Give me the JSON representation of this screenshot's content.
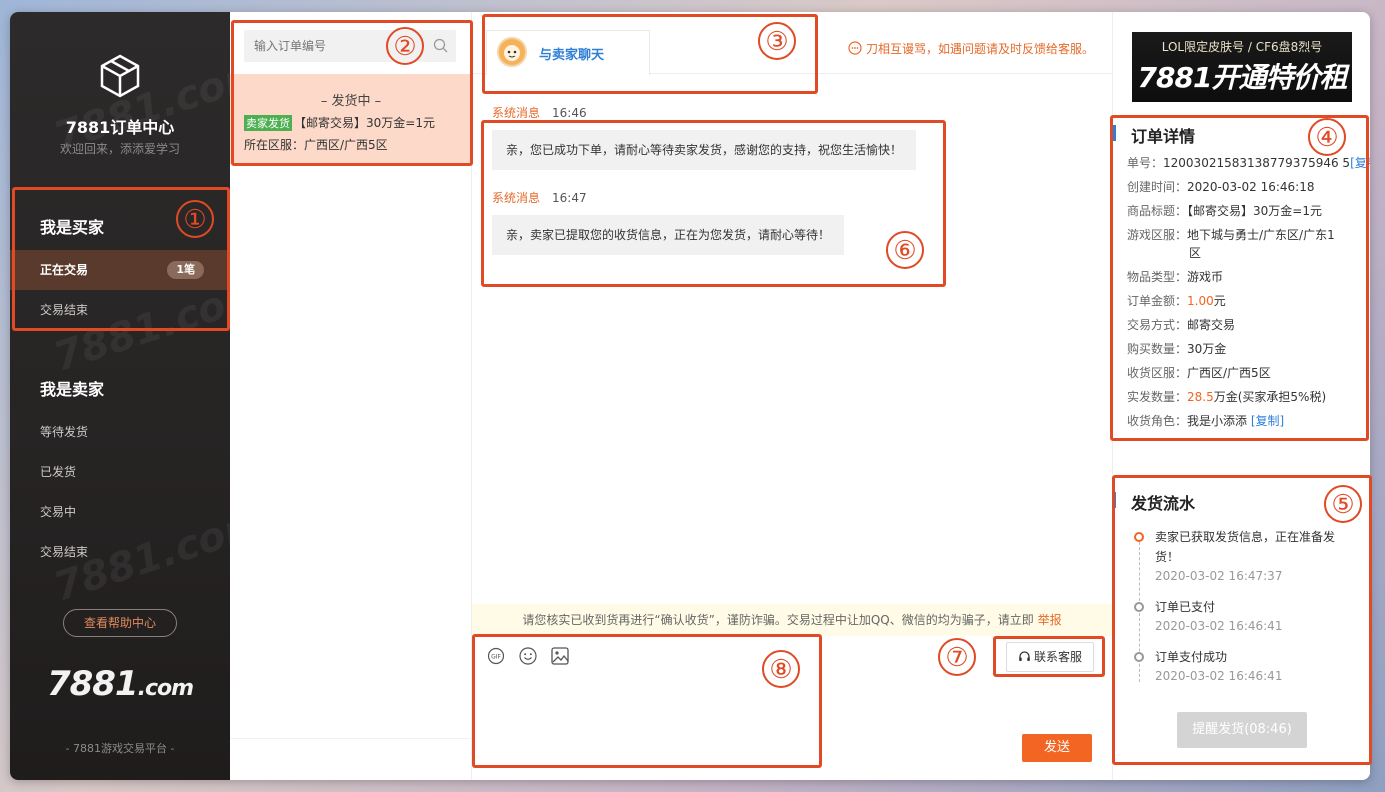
{
  "sidebar": {
    "title": "7881订单中心",
    "subtitle": "欢迎回来，添添爱学习",
    "buyer_title": "我是买家",
    "buyer_items": [
      {
        "label": "正在交易",
        "badge": "1笔"
      },
      {
        "label": "交易结束"
      }
    ],
    "seller_title": "我是卖家",
    "seller_items": [
      {
        "label": "等待发货"
      },
      {
        "label": "已发货"
      },
      {
        "label": "交易中"
      },
      {
        "label": "交易结束"
      }
    ],
    "help_button": "查看帮助中心",
    "brand_main": "7881",
    "brand_suffix": ".com",
    "footer": "- 7881游戏交易平台 -"
  },
  "orders": {
    "search_placeholder": "输入订单编号",
    "card": {
      "status": "– 发货中 –",
      "tag": "卖家发货",
      "title": "【邮寄交易】30万金=1元",
      "server": "所在区服：广西区/广西5区"
    }
  },
  "chat": {
    "tab_label": "与卖家聊天",
    "notice": "刀相互谩骂，如遇问题请及时反馈给客服。",
    "messages": [
      {
        "sender": "系统消息",
        "time": "16:46",
        "text": "亲，您已成功下单，请耐心等待卖家发货，感谢您的支持，祝您生活愉快！"
      },
      {
        "sender": "系统消息",
        "time": "16:47",
        "text": "亲，卖家已提取您的收货信息，正在为您发货，请耐心等待！"
      }
    ],
    "warning": "请您核实已收到货再进行“确认收货”，谨防诈骗。交易过程中让加QQ、微信的均为骗子，请立即",
    "warning_link": "举报",
    "cs_button": "联系客服",
    "send_button": "发送",
    "editor_value": ""
  },
  "right": {
    "ad_line1": "LOL限定皮肤号 / CF6盘8烈号",
    "ad_line2": "7881开通特价租号！",
    "detail_title": "订单详情",
    "details": [
      {
        "k": "单号：",
        "v": "12003021583138779375946 5",
        "extra": "[复制]"
      },
      {
        "k": "创建时间：",
        "v": "2020-03-02 16:46:18"
      },
      {
        "k": "商品标题：",
        "v": "【邮寄交易】30万金=1元"
      },
      {
        "k": "游戏区服：",
        "v": "地下城与勇士/广东区/广东1"
      },
      {
        "k": "",
        "v": "区"
      },
      {
        "k": "物品类型：",
        "v": "游戏币"
      },
      {
        "k": "订单金额：",
        "v": "1.00",
        "suffix": "元"
      },
      {
        "k": "交易方式：",
        "v": "邮寄交易"
      },
      {
        "k": "购买数量：",
        "v": "30万金"
      },
      {
        "k": "收货区服：",
        "v": "广西区/广西5区"
      },
      {
        "k": "实发数量：",
        "v": "28.5",
        "suffix": "万金(买家承担5%税)"
      },
      {
        "k": "收货角色：",
        "v": "我是小添添",
        "extra": "[复制]"
      }
    ],
    "flow_title": "发货流水",
    "flow": [
      {
        "text": "卖家已获取发货信息，正在准备发",
        "text2": "货！",
        "time": "2020-03-02 16:47:37"
      },
      {
        "text": "订单已支付",
        "time": "2020-03-02 16:46:41"
      },
      {
        "text": "订单支付成功",
        "time": "2020-03-02 16:46:41"
      }
    ],
    "remind_button": "提醒发货(08:46)"
  },
  "annotations": [
    "①",
    "②",
    "③",
    "④",
    "⑤",
    "⑥",
    "⑦",
    "⑧"
  ],
  "colors": {
    "accent": "#f26522",
    "link": "#2f7fd6",
    "annotation": "#e04a25",
    "sidebar_bg": "#2c2a2a"
  }
}
